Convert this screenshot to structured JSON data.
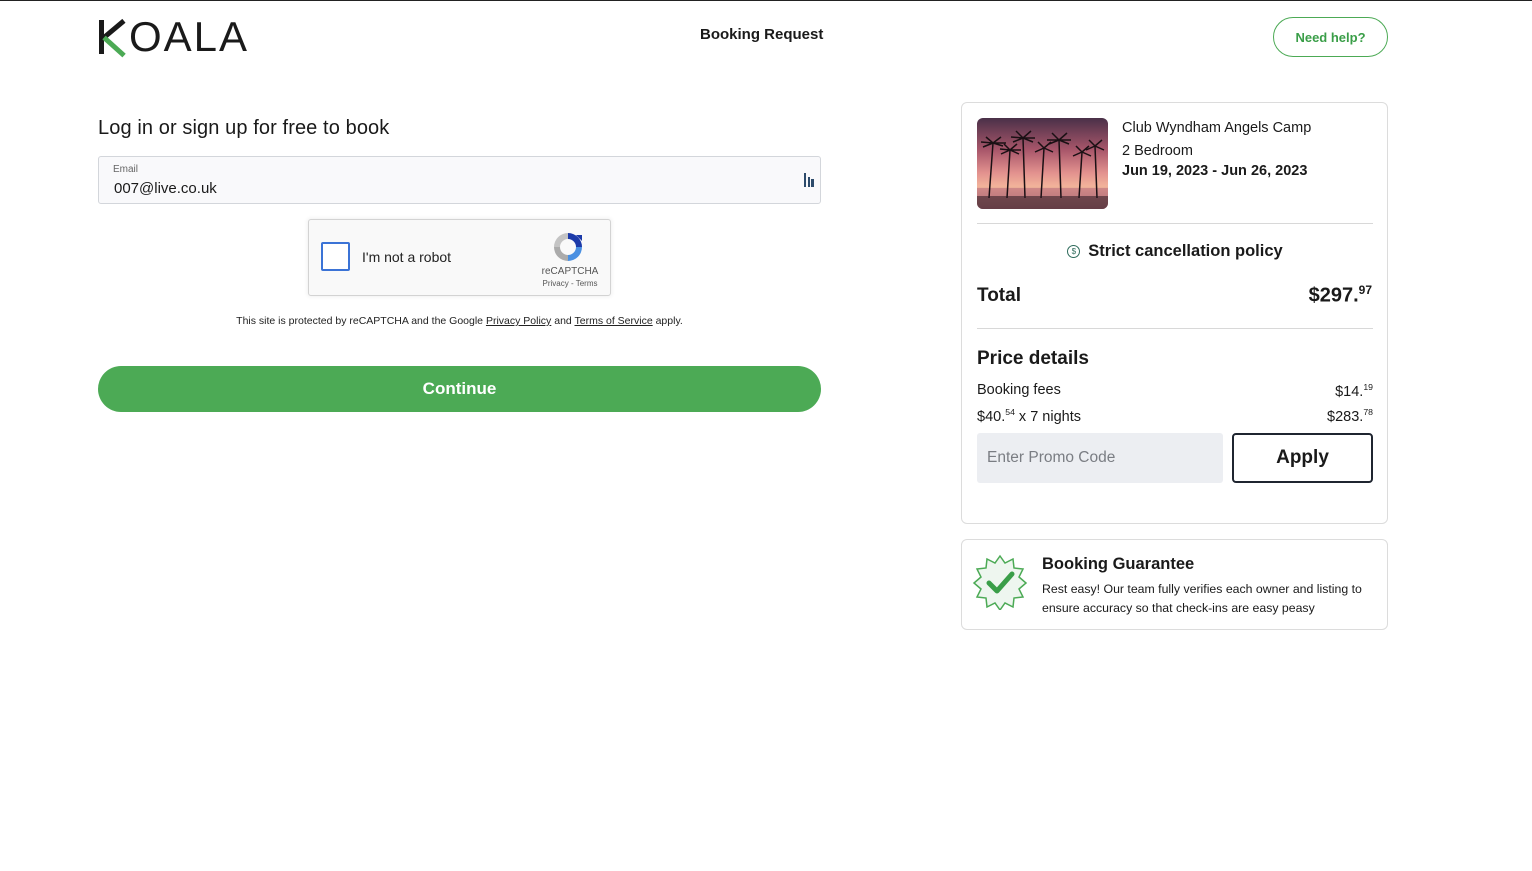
{
  "header": {
    "logo_text": "KOALA",
    "logo_rest": "OALA",
    "title": "Booking Request",
    "help_label": "Need help?"
  },
  "login": {
    "heading": "Log in or sign up for free to book",
    "email_label": "Email",
    "email_value": "007@live.co.uk",
    "continue_label": "Continue"
  },
  "recaptcha": {
    "label": "I'm not a robot",
    "brand": "reCAPTCHA",
    "privacy": "Privacy",
    "separator": " - ",
    "terms": "Terms",
    "note_prefix": "This site is protected by reCAPTCHA and the Google ",
    "note_privacy": "Privacy Policy",
    "note_and": " and ",
    "note_terms": "Terms of Service",
    "note_suffix": " apply."
  },
  "summary": {
    "property_name": "Club Wyndham Angels Camp",
    "bedrooms": "2 Bedroom",
    "dates": "Jun 19, 2023 - Jun 26, 2023",
    "cancellation_policy": "Strict cancellation policy",
    "total_label": "Total",
    "total_main": "$297.",
    "total_cents": "97",
    "price_details_heading": "Price details",
    "rows": [
      {
        "label_main": "Booking fees",
        "label_cents": "",
        "label_suffix": "",
        "value_main": "$14.",
        "value_cents": "19"
      },
      {
        "label_main": "$40.",
        "label_cents": "54",
        "label_suffix": " x 7 nights",
        "value_main": "$283.",
        "value_cents": "78"
      }
    ],
    "promo_placeholder": "Enter Promo Code",
    "apply_label": "Apply"
  },
  "guarantee": {
    "title": "Booking Guarantee",
    "text": "Rest easy! Our team fully verifies each owner and listing to ensure accuracy so that check-ins are easy peasy"
  },
  "colors": {
    "brand_green": "#4caa55",
    "recaptcha_blue": "#3b73d6",
    "dark_text": "#1a1a1a"
  },
  "icons": {
    "extension": "password-manager-icon",
    "recaptcha": "recaptcha-logo-icon",
    "cancellation": "info-circle-icon",
    "guarantee": "verified-badge-icon"
  }
}
